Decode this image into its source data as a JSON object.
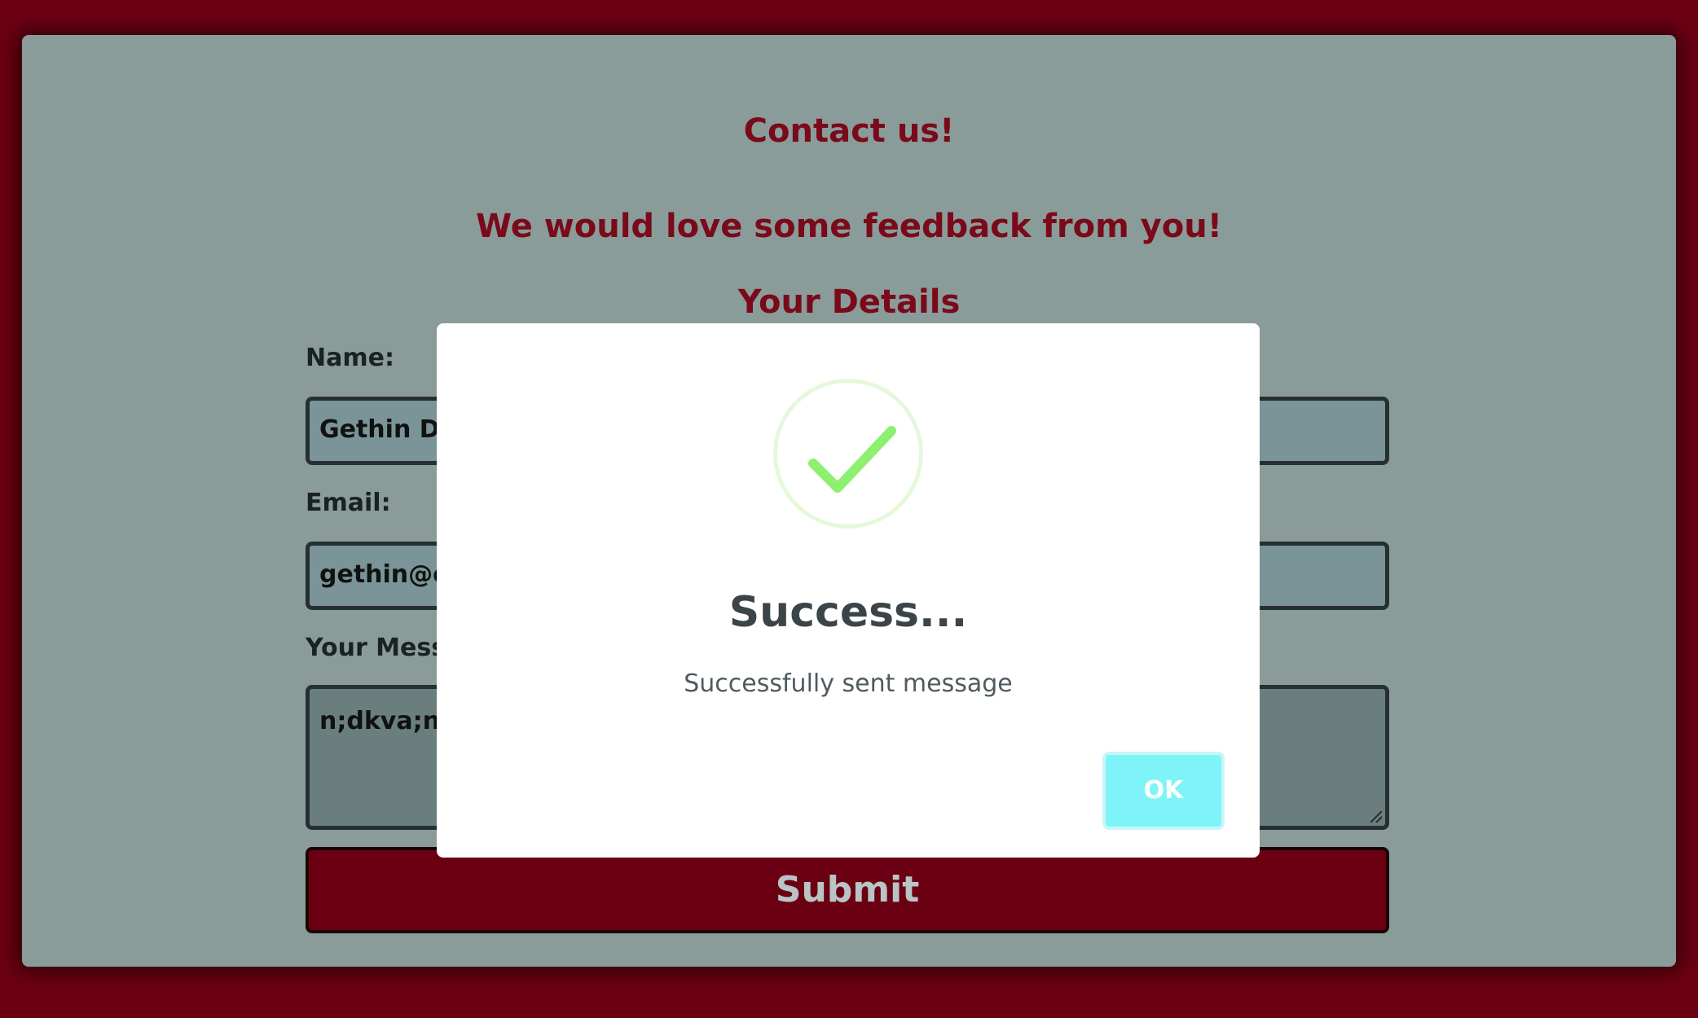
{
  "page": {
    "title": "Contact us!",
    "subtitle": "We would love some feedback from you!",
    "section_title": "Your Details"
  },
  "form": {
    "name_label": "Name:",
    "name_value": "Gethin Da",
    "email_label": "Email:",
    "email_value": "gethin@cr",
    "message_label": "Your Mess",
    "message_value": "n;dkva;nz",
    "submit_label": "Submit"
  },
  "modal": {
    "icon": "success-check-icon",
    "title": "Success...",
    "text": "Successfully sent message",
    "ok_label": "OK"
  },
  "colors": {
    "background": "#6b0012",
    "card": "#8a9c9a",
    "heading": "#7a0a1a",
    "check": "#8ef070",
    "ok_button": "#7ef4f8"
  }
}
